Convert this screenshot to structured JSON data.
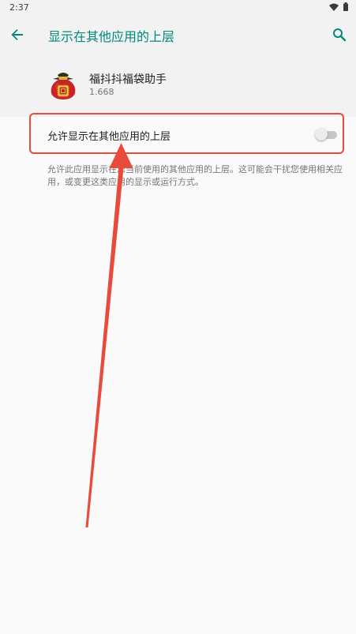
{
  "status_bar": {
    "time": "2:37",
    "icons": [
      "wifi-icon",
      "battery-icon"
    ]
  },
  "app_bar": {
    "back_icon": "arrow-left-icon",
    "title": "显示在其他应用的上层",
    "search_icon": "search-icon"
  },
  "app_info": {
    "icon": "lucky-bag-icon",
    "name": "福抖抖福袋助手",
    "version": "1.668"
  },
  "setting": {
    "label": "允许显示在其他应用的上层",
    "enabled": false
  },
  "description": "允许此应用显示在您当前使用的其他应用的上层。这可能会干扰您使用相关应用，或变更这类应用的显示或运行方式。",
  "colors": {
    "accent": "#00897b",
    "background": "#fafafa",
    "header_background": "#f2f2f2",
    "annotation": "#e84b3c"
  }
}
